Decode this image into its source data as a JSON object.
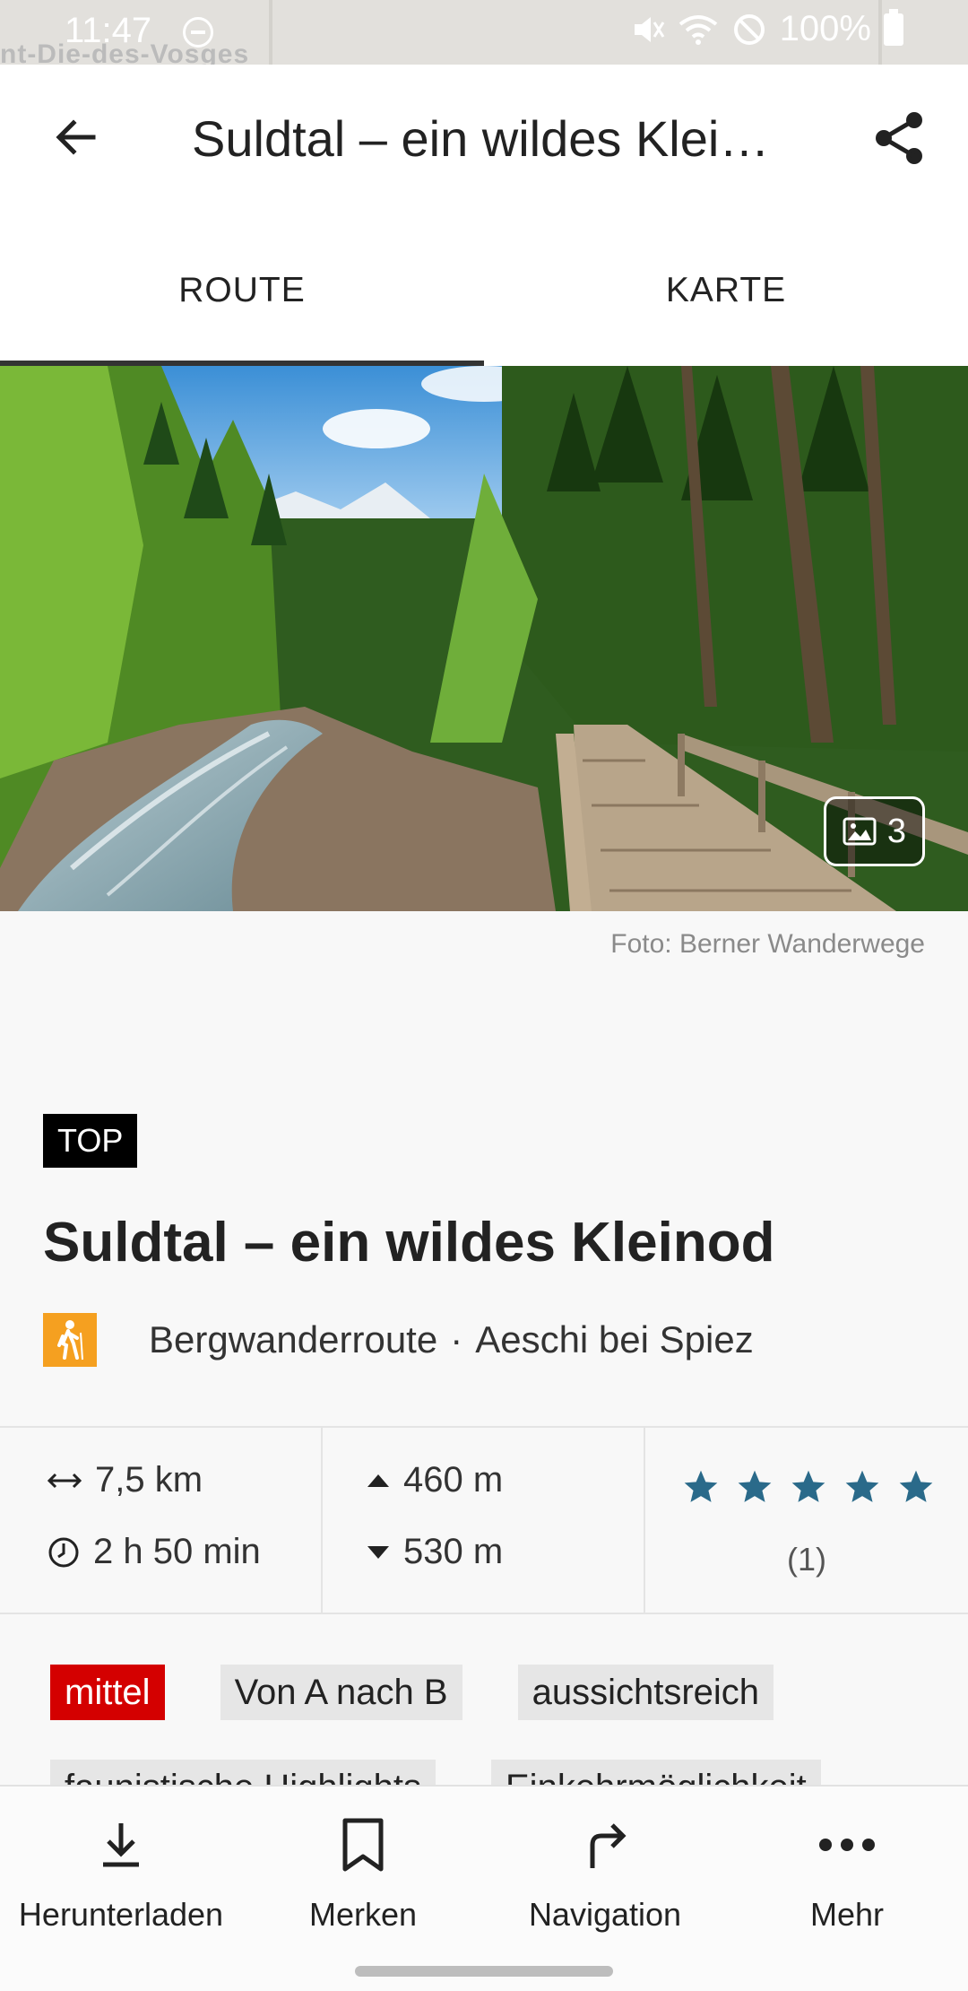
{
  "status_bar": {
    "time": "11:47",
    "battery": "100%",
    "background_map_text": "nt-Die-des-Vosges"
  },
  "app_bar": {
    "title": "Suldtal – ein wildes Klei…"
  },
  "tabs": [
    {
      "label": "ROUTE",
      "active": true
    },
    {
      "label": "KARTE",
      "active": false
    }
  ],
  "hero": {
    "photo_count": "3",
    "photo_credit": "Foto: Berner Wanderwege"
  },
  "route": {
    "badge": "TOP",
    "title": "Suldtal – ein wildes Kleinod",
    "type": "Bergwanderroute",
    "separator": "·",
    "location": "Aeschi bei Spiez",
    "type_icon_color": "#f5a020"
  },
  "stats": {
    "distance": "7,5 km",
    "duration": "2 h 50 min",
    "ascent": "460 m",
    "descent": "530 m",
    "rating_stars": 5,
    "rating_count": "(1)",
    "star_color": "#2a6a8a"
  },
  "tags": [
    {
      "label": "mittel",
      "kind": "level",
      "color": "#d40000"
    },
    {
      "label": "Von A nach B",
      "kind": "default"
    },
    {
      "label": "aussichtsreich",
      "kind": "default"
    }
  ],
  "tags_row2": [
    {
      "label": "faunistische Highlights"
    },
    {
      "label": "Einkehrmöglichkeit"
    }
  ],
  "bottom_nav": [
    {
      "label": "Herunterladen",
      "icon": "download-icon"
    },
    {
      "label": "Merken",
      "icon": "bookmark-icon"
    },
    {
      "label": "Navigation",
      "icon": "turn-right-icon"
    },
    {
      "label": "Mehr",
      "icon": "more-horizontal-icon"
    }
  ]
}
